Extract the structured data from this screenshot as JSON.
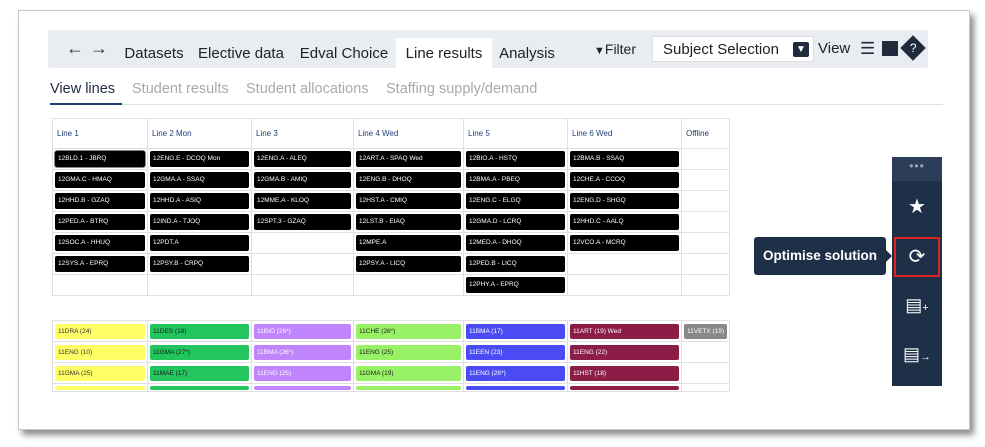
{
  "nav": {
    "back": "←",
    "forward": "→"
  },
  "tabs": [
    {
      "label": "Datasets"
    },
    {
      "label": "Elective data"
    },
    {
      "label": "Edval Choice"
    },
    {
      "label": "Line results"
    },
    {
      "label": "Analysis"
    }
  ],
  "toolbar": {
    "filter_label": "Filter",
    "subject_selection": "Subject Selection",
    "view_label": "View"
  },
  "subtabs": [
    "View lines",
    "Student results",
    "Student allocations",
    "Staffing supply/demand"
  ],
  "lines_table": {
    "headers": [
      "Line 1",
      "Line 2  Mon",
      "Line 3",
      "Line 4  Wed",
      "Line 5",
      "Line 6  Wed",
      "Offline"
    ],
    "rows": [
      [
        "12BLD.1 - JBRQ",
        "12ENG.E - DCOQ Mon",
        "12ENG.A - ALEQ",
        "12ART.A - SPAQ Wed",
        "12BIO.A - HSTQ",
        "12BMA.B - SSAQ",
        ""
      ],
      [
        "12GMA.C - HMAQ",
        "12GMA.A - SSAQ",
        "12GMA.B - AMIQ",
        "12ENG.B - DHOQ",
        "12BMA.A - PBEQ",
        "12CHE.A - CCOQ",
        ""
      ],
      [
        "12HHD.B - GZAQ",
        "12HHD.A - ASIQ",
        "12MME.A - KLOQ",
        "12HST.A - CMIQ",
        "12ENG.C - ELGQ",
        "12ENG.D - SHGQ",
        ""
      ],
      [
        "12PED.A - BTRQ",
        "12IND.A - TJOQ",
        "12SPT.3 - GZAQ",
        "12LST.B - EIAQ",
        "12GMA.D - LCRQ",
        "12HHD.C - AALQ",
        ""
      ],
      [
        "12SOC.A - HHUQ",
        "12PDT.A",
        "",
        "12MPE.A",
        "12MED.A - DHOQ",
        "12VCO.A - MCRQ",
        ""
      ],
      [
        "12SYS.A - EPRQ",
        "12PSY.B - CRPQ",
        "",
        "12PSY.A - LICQ",
        "12PED.B - LICQ",
        "",
        ""
      ],
      [
        "",
        "",
        "",
        "",
        "12PHY.A - EPRQ",
        "",
        ""
      ]
    ]
  },
  "year11_table": {
    "rows": [
      [
        "11DRA (24)",
        "11DES (18)",
        "11BIO (26*)",
        "11CHE (26*)",
        "11BMA (17)",
        "11ART (19) Wed",
        "11VETX (19)"
      ],
      [
        "11ENG (10)",
        "11GMA (27*)",
        "11BMA (26*)",
        "11ENG (25)",
        "11EEN (23)",
        "11ENG (22)",
        ""
      ],
      [
        "11GMA (25)",
        "11MAE (17)",
        "11ENG (25)",
        "11GMA (19)",
        "11ENG (26*)",
        "11HST (18)",
        ""
      ],
      [
        "",
        "",
        "",
        "",
        "",
        "",
        ""
      ]
    ],
    "column_colors": [
      "#ffff66",
      "#22c55e",
      "#c084fc",
      "#99f266",
      "#4b4bf5",
      "#8b1d47",
      "#888888"
    ],
    "column_text_colors": [
      "#333333",
      "#1a1a1a",
      "#ffffff",
      "#1a1a1a",
      "#ffffff",
      "#ffffff",
      "#ffffff"
    ]
  },
  "sidebar": {
    "dots": "•••",
    "icons": [
      "star-alert-icon",
      "optimise-icon",
      "add-document-icon",
      "export-document-icon"
    ]
  },
  "tooltip": {
    "label": "Optimise solution"
  },
  "colors": {
    "accent": "#1e2f48",
    "highlight_border": "#e02424"
  }
}
